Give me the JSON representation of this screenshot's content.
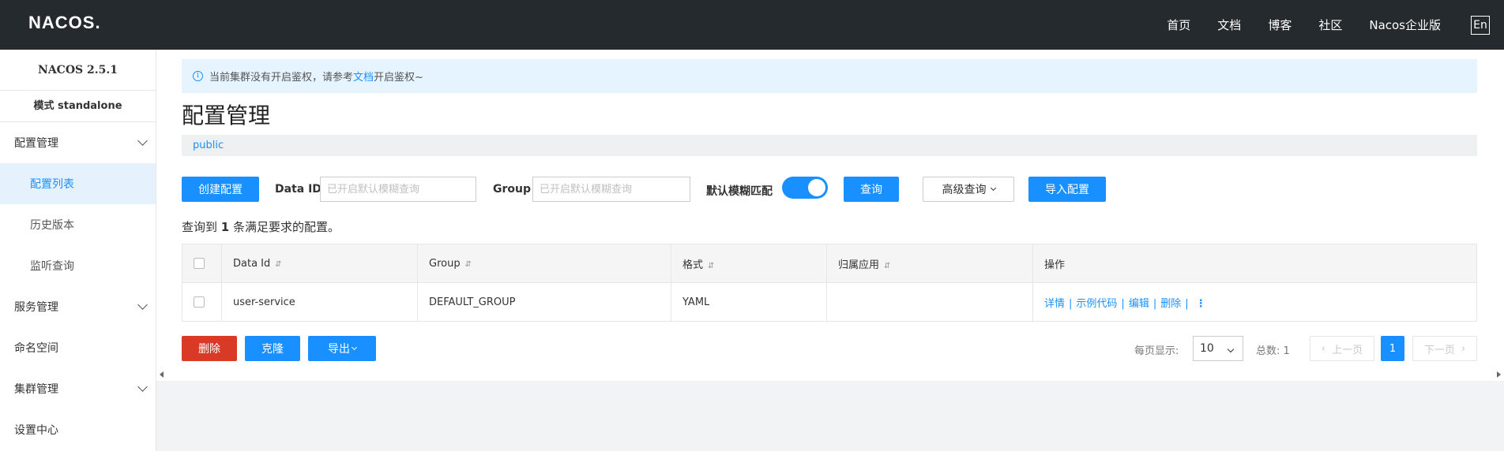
{
  "header": {
    "logo": "NACOS.",
    "nav": [
      "首页",
      "文档",
      "博客",
      "社区",
      "Nacos企业版"
    ],
    "lang": "En"
  },
  "sidebar": {
    "version": "NACOS 2.5.1",
    "mode": "模式 standalone",
    "menu": {
      "config_mgmt": "配置管理",
      "config_list": "配置列表",
      "history": "历史版本",
      "listen_query": "监听查询",
      "service_mgmt": "服务管理",
      "namespace": "命名空间",
      "cluster_mgmt": "集群管理",
      "settings": "设置中心"
    }
  },
  "notice": {
    "text_before": "当前集群没有开启鉴权，请参考",
    "link": "文档",
    "text_after": "开启鉴权~"
  },
  "page_title": "配置管理",
  "namespace_tab": "public",
  "search": {
    "create_button": "创建配置",
    "data_id_label": "Data ID",
    "data_id_placeholder": "已开启默认模糊查询",
    "group_label": "Group",
    "group_placeholder": "已开启默认模糊查询",
    "fuzzy_label": "默认模糊匹配",
    "fuzzy_enabled": true,
    "query_button": "查询",
    "advanced_button": "高级查询",
    "import_button": "导入配置"
  },
  "result": {
    "prefix": "查询到",
    "count": "1",
    "suffix": "条满足要求的配置。"
  },
  "table": {
    "columns": [
      "Data Id",
      "Group",
      "格式",
      "归属应用",
      "操作"
    ],
    "rows": [
      {
        "data_id": "user-service",
        "group": "DEFAULT_GROUP",
        "format": "YAML",
        "app": "",
        "actions": [
          "详情",
          "示例代码",
          "编辑",
          "删除"
        ]
      }
    ],
    "action_separator": "|",
    "more": "⋮"
  },
  "footer": {
    "delete_button": "删除",
    "clone_button": "克隆",
    "export_button": "导出",
    "page_size_label": "每页显示:",
    "page_size": "10",
    "total_label": "总数: 1",
    "prev": "上一页",
    "current_page": "1",
    "next": "下一页"
  },
  "colors": {
    "primary": "#1890ff",
    "danger": "#d93a26",
    "topbar": "#252a2f"
  }
}
